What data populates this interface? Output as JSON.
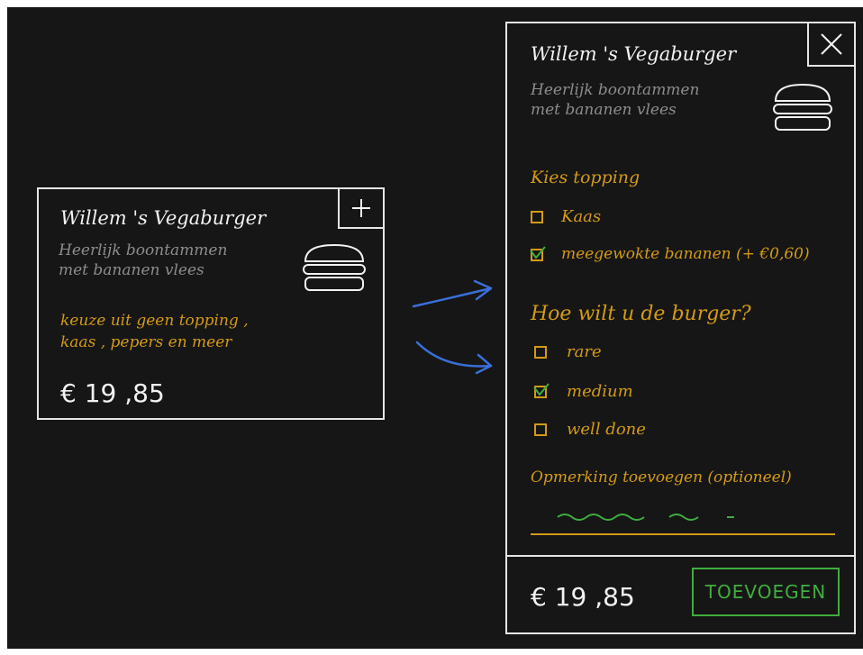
{
  "small_card": {
    "title": "Willem 's Vegaburger",
    "description_line1": "Heerlijk boontammen",
    "description_line2": "met bananen vlees",
    "topping_summary_line1": "keuze uit geen topping ,",
    "topping_summary_line2": "kaas , pepers en meer",
    "price": "€ 19 ,85",
    "add_icon": "plus-icon",
    "burger_icon": "burger-icon"
  },
  "detail_card": {
    "title": "Willem 's Vegaburger",
    "description_line1": "Heerlijk boontammen",
    "description_line2": "met bananen vlees",
    "close_icon": "close-icon",
    "burger_icon": "burger-icon",
    "topping_heading": "Kies topping",
    "toppings": [
      {
        "label": "Kaas",
        "checked": false
      },
      {
        "label": "meegewokte bananen (+ €0,60)",
        "checked": true
      }
    ],
    "doneness_heading": "Hoe wilt u de burger?",
    "doneness": [
      {
        "label": "rare",
        "checked": false
      },
      {
        "label": "medium",
        "checked": true
      },
      {
        "label": "well done",
        "checked": false
      }
    ],
    "note_label": "Opmerking toevoegen (optioneel)",
    "price": "€ 19 ,85",
    "add_button_label": "TOEVOEGEN"
  },
  "colors": {
    "background": "#161616",
    "outline": "#e6e6e6",
    "accent_gold": "#d39a17",
    "accent_green": "#3fae3f",
    "arrow_blue": "#3a6fd8",
    "muted": "#8c8c8c"
  }
}
